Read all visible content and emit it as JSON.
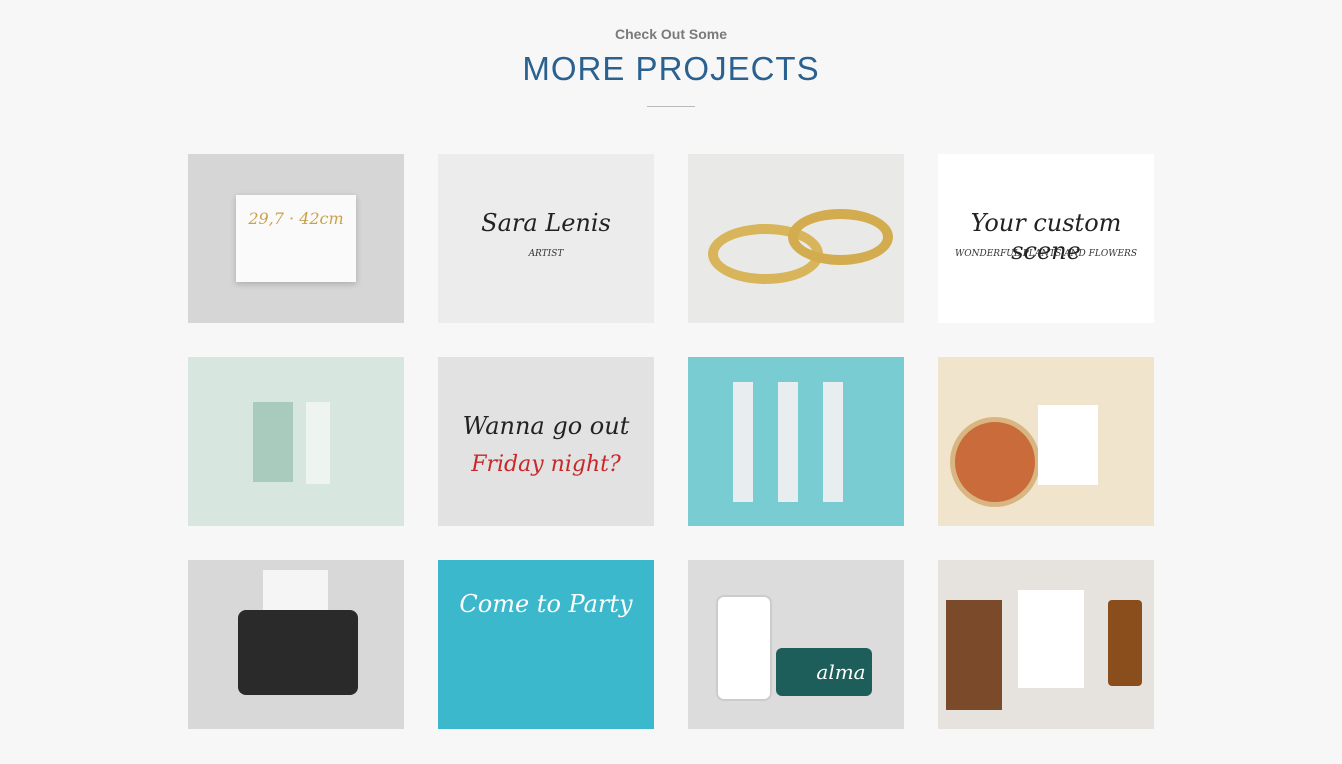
{
  "section": {
    "subtitle": "Check Out Some",
    "title": "MORE PROJECTS"
  },
  "projects": [
    {
      "name": "a3-poster-mockup",
      "bg": "#d6d6d6",
      "text": "29,7 · 42cm"
    },
    {
      "name": "sara-lenis-font",
      "bg": "#ececec",
      "text": "Sara Lenis",
      "sub": "ARTIST"
    },
    {
      "name": "gold-rings",
      "bg": "#e9e9e7",
      "text": ""
    },
    {
      "name": "custom-scene-creator",
      "bg": "#ffffff",
      "text": "Your custom scene",
      "sub": "WONDERFUL PLANTS AND FLOWERS"
    },
    {
      "name": "cosmetic-packaging",
      "bg": "#d7e6df",
      "text": ""
    },
    {
      "name": "friday-night-font",
      "bg": "#e2e2e2",
      "text": "Wanna go out",
      "sub": "Friday night?"
    },
    {
      "name": "watercolor-fruits-cards",
      "bg": "#79ccd2",
      "text": ""
    },
    {
      "name": "pizza-branding",
      "bg": "#f1e4cc",
      "text": ""
    },
    {
      "name": "typewriter-mockup",
      "bg": "#d8d8d8",
      "text": ""
    },
    {
      "name": "party-invitation",
      "bg": "#3cb8cc",
      "text": "Come to Party"
    },
    {
      "name": "alma-app-mockup",
      "bg": "#dcdcdc",
      "text": "alma"
    },
    {
      "name": "stationery-mockup",
      "bg": "#e6e3df",
      "text": ""
    }
  ]
}
